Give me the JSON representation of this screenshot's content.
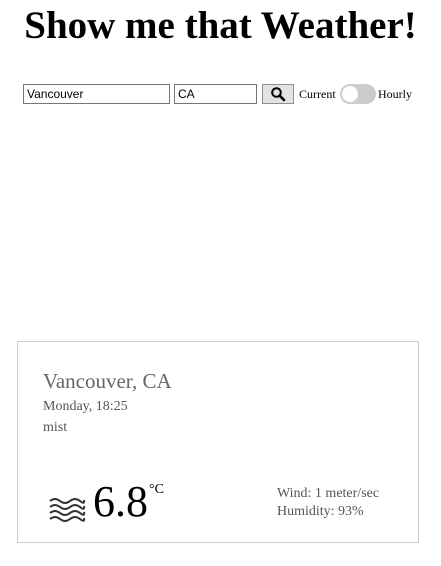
{
  "header": {
    "title": "Show me that Weather!"
  },
  "search": {
    "city_value": "Vancouver",
    "country_value": "CA",
    "search_icon": "search-icon",
    "toggle": {
      "left_label": "Current",
      "right_label": "Hourly",
      "state": "off"
    }
  },
  "weather": {
    "location": "Vancouver, CA",
    "datetime": "Monday, 18:25",
    "condition": "mist",
    "icon": "mist-icon",
    "temperature": "6.8",
    "unit": "°C",
    "wind": "Wind: 1 meter/sec",
    "humidity": "Humidity: 93%"
  },
  "colors": {
    "toggle_track": "#cccccc",
    "card_border": "#cccccc",
    "muted_text": "#555555"
  }
}
